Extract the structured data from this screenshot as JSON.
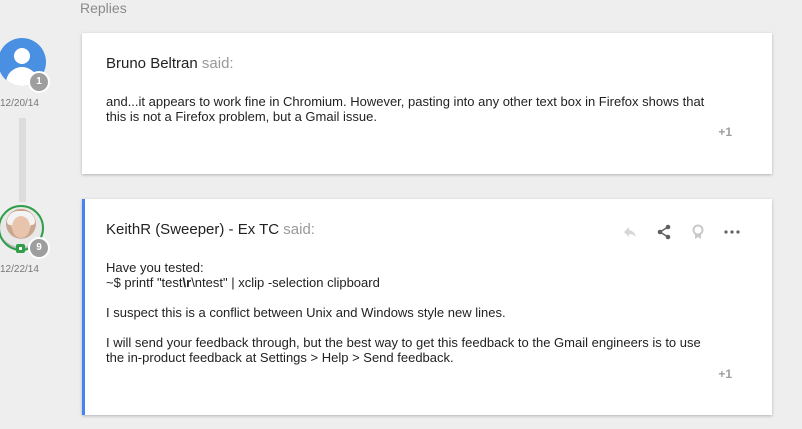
{
  "replies_heading": "Replies",
  "replies": [
    {
      "author": "Bruno Beltran",
      "said": "said:",
      "date": "12/20/14",
      "badge_count": "1",
      "body": [
        "and...it appears to work fine in Chromium. However, pasting into any other text box in Firefox shows that this is not a Firefox problem, but a Gmail issue."
      ],
      "plus_one": "+1"
    },
    {
      "author": "KeithR (Sweeper) - Ex TC",
      "said": "said:",
      "date": "12/22/14",
      "badge_count": "9",
      "body_line1": "Have you tested:",
      "body_line2a": "~$ printf \"test",
      "body_line2b": "\\r",
      "body_line2c": "\\ntest\" | xclip -selection clipboard",
      "body_p2": "I suspect this is a conflict between Unix and Windows style new lines.",
      "body_p3": "I will send your feedback through, but the best way to get this feedback to the Gmail engineers is to use the in-product feedback at Settings > Help > Send feedback.",
      "plus_one": "+1",
      "actions": [
        "reply-icon",
        "share-icon",
        "award-icon",
        "more-icon"
      ]
    }
  ],
  "colors": {
    "accent": "#4285f4",
    "avatar_default": "#4a90e2",
    "rank_green": "#2e9e48"
  }
}
